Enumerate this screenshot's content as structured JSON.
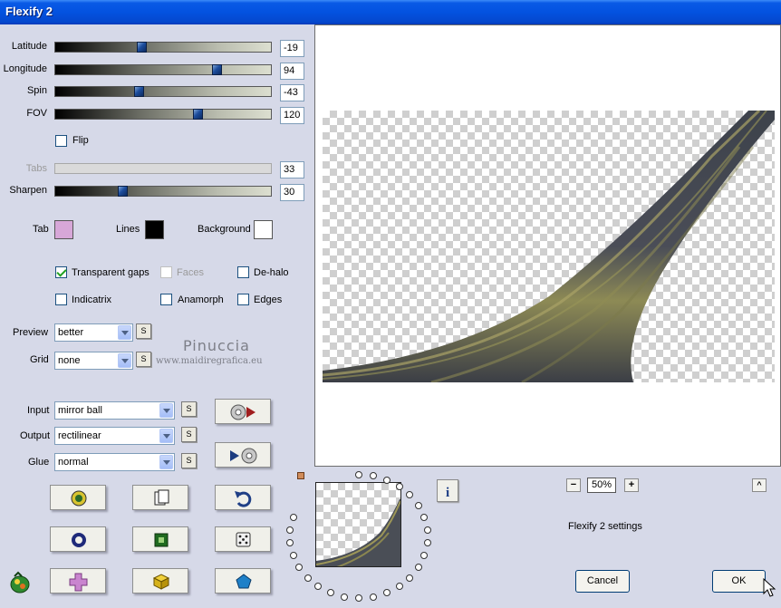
{
  "window": {
    "title": "Flexify 2"
  },
  "sliders": [
    {
      "label": "Latitude",
      "value": "-19",
      "position": 0.4
    },
    {
      "label": "Longitude",
      "value": "94",
      "position": 0.74
    },
    {
      "label": "Spin",
      "value": "-43",
      "position": 0.38
    },
    {
      "label": "FOV",
      "value": "120",
      "position": 0.66
    },
    {
      "label": "Tabs",
      "value": "33",
      "enabled": false
    },
    {
      "label": "Sharpen",
      "value": "30",
      "position": 0.3
    }
  ],
  "flip": {
    "label": "Flip",
    "checked": false
  },
  "colors": {
    "tab": {
      "label": "Tab",
      "color": "#d7a7d8"
    },
    "lines": {
      "label": "Lines",
      "color": "#000000"
    },
    "background": {
      "label": "Background",
      "color": "#ffffff"
    }
  },
  "options": {
    "transparent_gaps": {
      "label": "Transparent gaps",
      "checked": true
    },
    "faces": {
      "label": "Faces",
      "checked": false,
      "enabled": false
    },
    "dehalo": {
      "label": "De-halo",
      "checked": false
    },
    "indicatrix": {
      "label": "Indicatrix",
      "checked": false
    },
    "anamorph": {
      "label": "Anamorph",
      "checked": false
    },
    "edges": {
      "label": "Edges",
      "checked": false
    }
  },
  "preview_select": {
    "label": "Preview",
    "value": "better"
  },
  "grid_select": {
    "label": "Grid",
    "value": "none"
  },
  "input_select": {
    "label": "Input",
    "value": "mirror ball"
  },
  "output_select": {
    "label": "Output",
    "value": "rectilinear"
  },
  "glue_select": {
    "label": "Glue",
    "value": "normal"
  },
  "small_button": "S",
  "watermark": {
    "line1": "Pinuccia",
    "line2": "www.maidiregrafica.eu"
  },
  "zoom": {
    "minus": "−",
    "value": "50%",
    "plus": "+",
    "up": "^"
  },
  "settings_label": "Flexify 2 settings",
  "buttons": {
    "cancel": "Cancel",
    "ok": "OK",
    "info": "i"
  },
  "icons": [
    "input-play-icon",
    "output-play-icon",
    "random-icon",
    "copy-icon",
    "undo-icon",
    "circle-icon",
    "square-icon",
    "dice-icon",
    "plugin-logo-icon",
    "plus-shape-icon",
    "cube-icon",
    "pentagon-icon",
    "info-icon"
  ]
}
